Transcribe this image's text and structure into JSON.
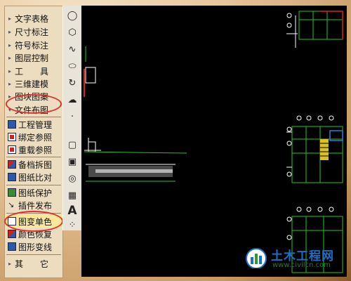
{
  "menu": {
    "top_items": [
      {
        "label": "文字表格",
        "arrow": "▸"
      },
      {
        "label": "尺寸标注",
        "arrow": "▸"
      },
      {
        "label": "符号标注",
        "arrow": "▸"
      },
      {
        "label": "图层控制",
        "arrow": "▸"
      },
      {
        "label": "工　　具",
        "arrow": "▸"
      },
      {
        "label": "三维建模",
        "arrow": "▸"
      },
      {
        "label": "图块图案",
        "arrow": "▸"
      },
      {
        "label": "文件布图",
        "arrow": "▾"
      }
    ],
    "sub_items": [
      {
        "label": "工程管理"
      },
      {
        "label": "绑定参照"
      },
      {
        "label": "重载参照"
      },
      {
        "label": "备档拆图"
      },
      {
        "label": "图纸比对"
      },
      {
        "label": "图纸保护"
      },
      {
        "label": "插件发布"
      },
      {
        "label": "图变单色"
      },
      {
        "label": "颜色恢复"
      },
      {
        "label": "图形变线"
      }
    ],
    "bottom_items": [
      {
        "label": "其　　它",
        "arrow": "▸"
      }
    ]
  },
  "toolbar": {
    "icons": [
      "circle-icon",
      "polygon-icon",
      "wave-icon",
      "ellipse-icon",
      "rotate-icon",
      "cloud-icon",
      "dot-icon",
      "rect-icon",
      "rect-icon-2",
      "camera-icon",
      "table-icon",
      "text-a-icon",
      "settings-dots-icon"
    ],
    "text_glyph": "A"
  },
  "watermark": {
    "title": "土木工程网",
    "url": "www.civilcn.com"
  },
  "colors": {
    "highlight": "#fbe79a",
    "annotation_red": "#e03030",
    "cad_green": "#27c427",
    "cad_white": "#ffffff",
    "cad_red": "#e02020"
  }
}
